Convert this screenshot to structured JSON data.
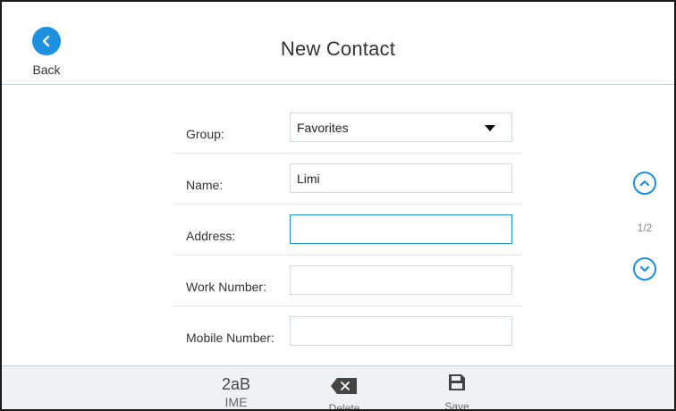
{
  "header": {
    "back_label": "Back",
    "title": "New Contact"
  },
  "form": {
    "group": {
      "label": "Group:",
      "value": "Favorites"
    },
    "name": {
      "label": "Name:",
      "value": "Limi"
    },
    "address": {
      "label": "Address:",
      "value": ""
    },
    "work_number": {
      "label": "Work Number:",
      "value": ""
    },
    "mobile_number": {
      "label": "Mobile Number:",
      "value": ""
    }
  },
  "pager": {
    "indicator": "1/2"
  },
  "footer": {
    "ime_value": "2aB",
    "ime_label": "IME",
    "delete_label": "Delete",
    "save_label": "Save"
  },
  "colors": {
    "accent": "#1e90e0",
    "footer_bg": "#eef2f5",
    "divider": "#e1e6ea"
  }
}
